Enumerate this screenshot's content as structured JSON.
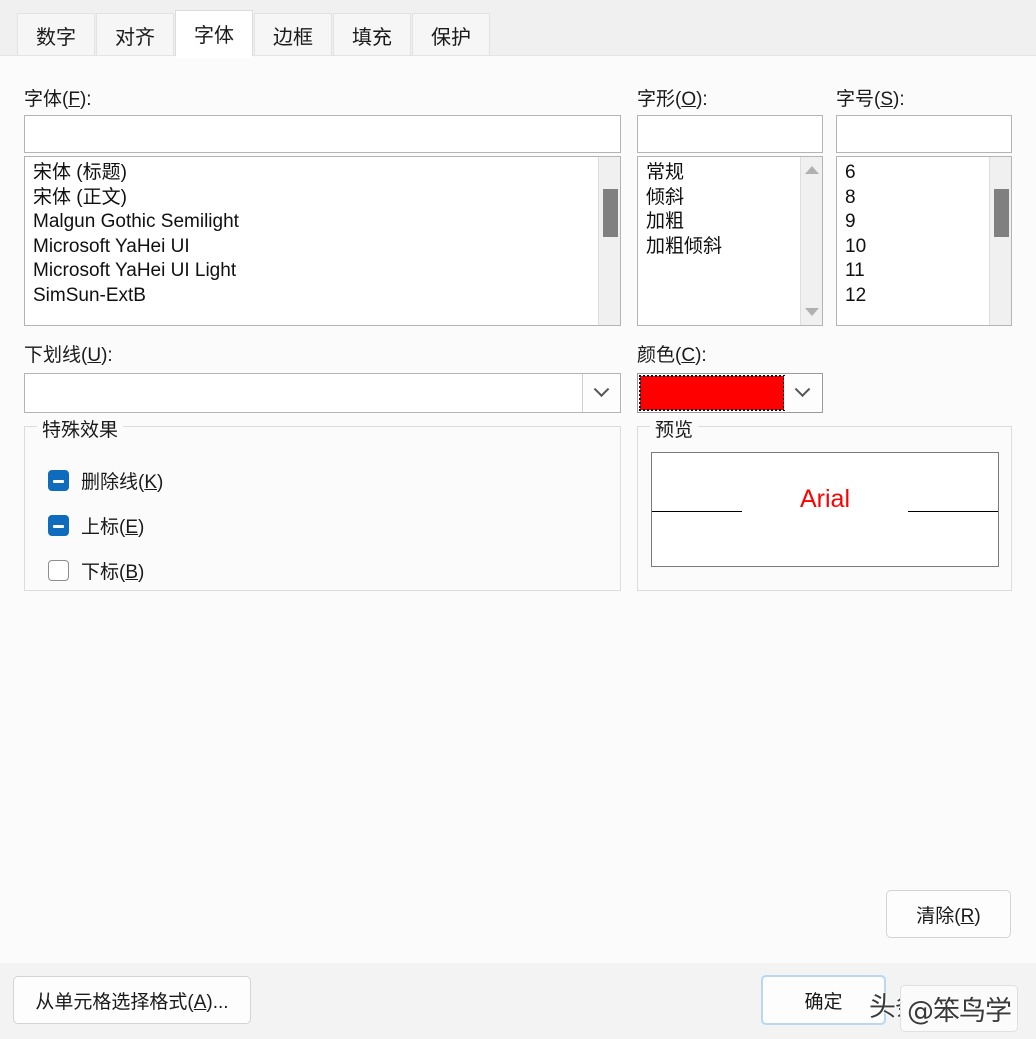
{
  "dialog": {
    "tabs": [
      {
        "label": "数字",
        "active": false
      },
      {
        "label": "对齐",
        "active": false
      },
      {
        "label": "字体",
        "active": true
      },
      {
        "label": "边框",
        "active": false
      },
      {
        "label": "填充",
        "active": false
      },
      {
        "label": "保护",
        "active": false
      }
    ]
  },
  "font_section": {
    "label": "字体(F):",
    "label_text": "字体(",
    "label_accel": "F",
    "label_tail": "):",
    "input_value": "",
    "items": [
      "宋体 (标题)",
      "宋体 (正文)",
      "Malgun Gothic Semilight",
      "Microsoft YaHei UI",
      "Microsoft YaHei UI Light",
      "SimSun-ExtB"
    ]
  },
  "style_section": {
    "label_text": "字形(",
    "label_accel": "O",
    "label_tail": "):",
    "input_value": "",
    "items": [
      "常规",
      "倾斜",
      "加粗",
      "加粗倾斜"
    ]
  },
  "size_section": {
    "label_text": "字号(",
    "label_accel": "S",
    "label_tail": "):",
    "input_value": "",
    "items": [
      "6",
      "8",
      "9",
      "10",
      "11",
      "12"
    ]
  },
  "underline_section": {
    "label_text": "下划线(",
    "label_accel": "U",
    "label_tail": "):",
    "value": "",
    "chevron_icon": "chevron-down-icon"
  },
  "color_section": {
    "label_text": "颜色(",
    "label_accel": "C",
    "label_tail": "):",
    "selected_color": "#FF0000",
    "chevron_icon": "chevron-down-icon"
  },
  "effects_group": {
    "title": "特殊效果",
    "items": [
      {
        "label_text": "删除线(",
        "label_accel": "K",
        "label_tail": ")",
        "state": "indeterminate"
      },
      {
        "label_text": "上标(",
        "label_accel": "E",
        "label_tail": ")",
        "state": "indeterminate"
      },
      {
        "label_text": "下标(",
        "label_accel": "B",
        "label_tail": ")",
        "state": "unchecked"
      }
    ]
  },
  "preview_group": {
    "title": "预览",
    "sample_text": "Arial",
    "sample_color": "#FF0000"
  },
  "buttons": {
    "clear": {
      "text": "清除(",
      "accel": "R",
      "tail": ")"
    },
    "pick_from_cell": {
      "text": "从单元格选择格式(",
      "accel": "A",
      "tail": ")..."
    },
    "ok": {
      "label": "确定"
    }
  },
  "watermark": {
    "text_a": "头条",
    "text_b": "@笨鸟学"
  }
}
